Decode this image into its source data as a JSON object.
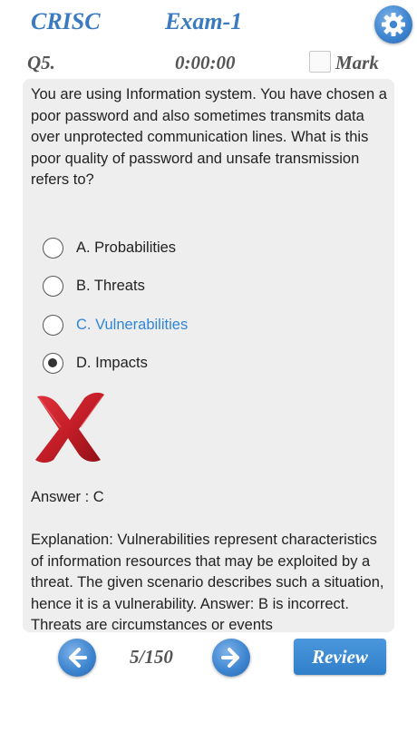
{
  "header": {
    "app_title": "CRISC",
    "exam_title": "Exam-1",
    "settings_icon": "gear-icon"
  },
  "status": {
    "question_number": "Q5.",
    "timer": "0:00:00",
    "mark_label": "Mark",
    "mark_checked": false
  },
  "question": {
    "text": "You are using Information system. You have chosen a poor password and also sometimes transmits data over unprotected communication lines. What is this poor quality of password and unsafe transmission refers to?"
  },
  "options": [
    {
      "label": "A. Probabilities",
      "selected": false,
      "correct": false
    },
    {
      "label": "B. Threats",
      "selected": false,
      "correct": false
    },
    {
      "label": "C. Vulnerabilities",
      "selected": false,
      "correct": true
    },
    {
      "label": "D. Impacts",
      "selected": true,
      "correct": false
    }
  ],
  "result_icon": "red-x-icon",
  "answer": "Answer : C",
  "explanation": "Explanation: Vulnerabilities represent characteristics of information resources that may be exploited by a threat. The given scenario describes such a situation, hence it is a vulnerability. Answer: B is incorrect. Threats are circumstances or events",
  "footer": {
    "progress": "5/150",
    "review_label": "Review"
  },
  "colors": {
    "brand_blue": "#3a7bbf",
    "correct_option": "#2f86d6",
    "wrong_mark": "#c9202a"
  }
}
